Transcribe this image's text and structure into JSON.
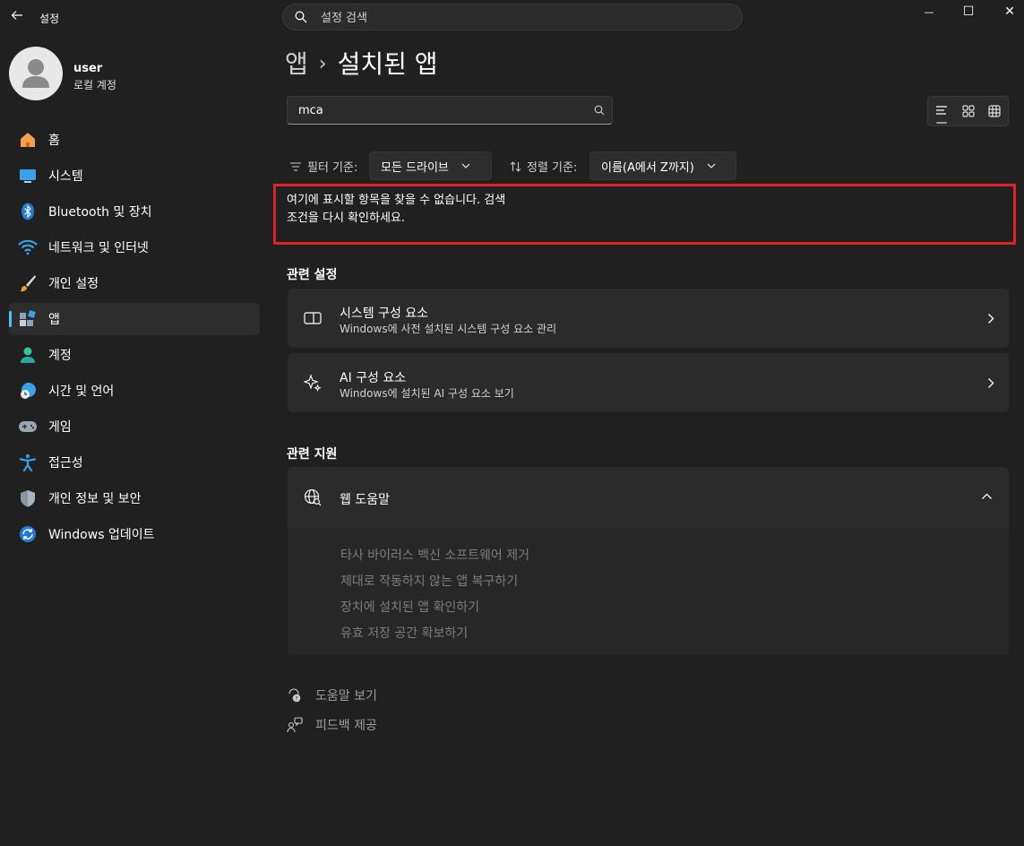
{
  "window": {
    "title": "설정",
    "minimize": "—",
    "maximize": "☐",
    "close": "✕"
  },
  "search": {
    "placeholder": "설정 검색"
  },
  "user": {
    "name": "user",
    "account_type": "로컬 계정"
  },
  "nav": [
    {
      "label": "홈",
      "icon": "home-icon"
    },
    {
      "label": "시스템",
      "icon": "system-icon"
    },
    {
      "label": "Bluetooth 및 장치",
      "icon": "bluetooth-icon"
    },
    {
      "label": "네트워크 및 인터넷",
      "icon": "wifi-icon"
    },
    {
      "label": "개인 설정",
      "icon": "brush-icon"
    },
    {
      "label": "앱",
      "icon": "apps-icon",
      "active": true
    },
    {
      "label": "계정",
      "icon": "account-icon"
    },
    {
      "label": "시간 및 언어",
      "icon": "time-language-icon"
    },
    {
      "label": "게임",
      "icon": "gamepad-icon"
    },
    {
      "label": "접근성",
      "icon": "accessibility-icon"
    },
    {
      "label": "개인 정보 및 보안",
      "icon": "shield-icon"
    },
    {
      "label": "Windows 업데이트",
      "icon": "update-icon"
    }
  ],
  "header": {
    "parent": "앱",
    "separator": "›",
    "title": "설치된 앱"
  },
  "app_search": {
    "value": "mca"
  },
  "filter": {
    "label": "필터 기준:",
    "value": "모든 드라이브"
  },
  "sort": {
    "label": "정렬 기준:",
    "value": "이름(A에서 Z까지)"
  },
  "empty_message": {
    "line1": "여기에 표시할 항목을 찾을 수 없습니다. 검색",
    "line2": "조건을 다시 확인하세요."
  },
  "related_settings": {
    "title": "관련 설정",
    "cards": [
      {
        "title": "시스템 구성 요소",
        "subtitle": "Windows에 사전 설치된 시스템 구성 요소 관리"
      },
      {
        "title": "AI 구성 요소",
        "subtitle": "Windows에 설치된 AI 구성 요소 보기"
      }
    ]
  },
  "related_support": {
    "title": "관련 지원",
    "expander": "웹 도움말",
    "links": [
      "타사 바이러스 백신 소프트웨어 제거",
      "제대로 작동하지 않는 앱 복구하기",
      "장치에 설치된 앱 확인하기",
      "유효 저장 공간 확보하기"
    ]
  },
  "footer": {
    "help": "도움말 보기",
    "feedback": "피드백 제공"
  },
  "colors": {
    "background": "#202020",
    "card": "#2b2b2b",
    "accent": "#4cc2ff",
    "highlight_border": "#e0202a"
  }
}
